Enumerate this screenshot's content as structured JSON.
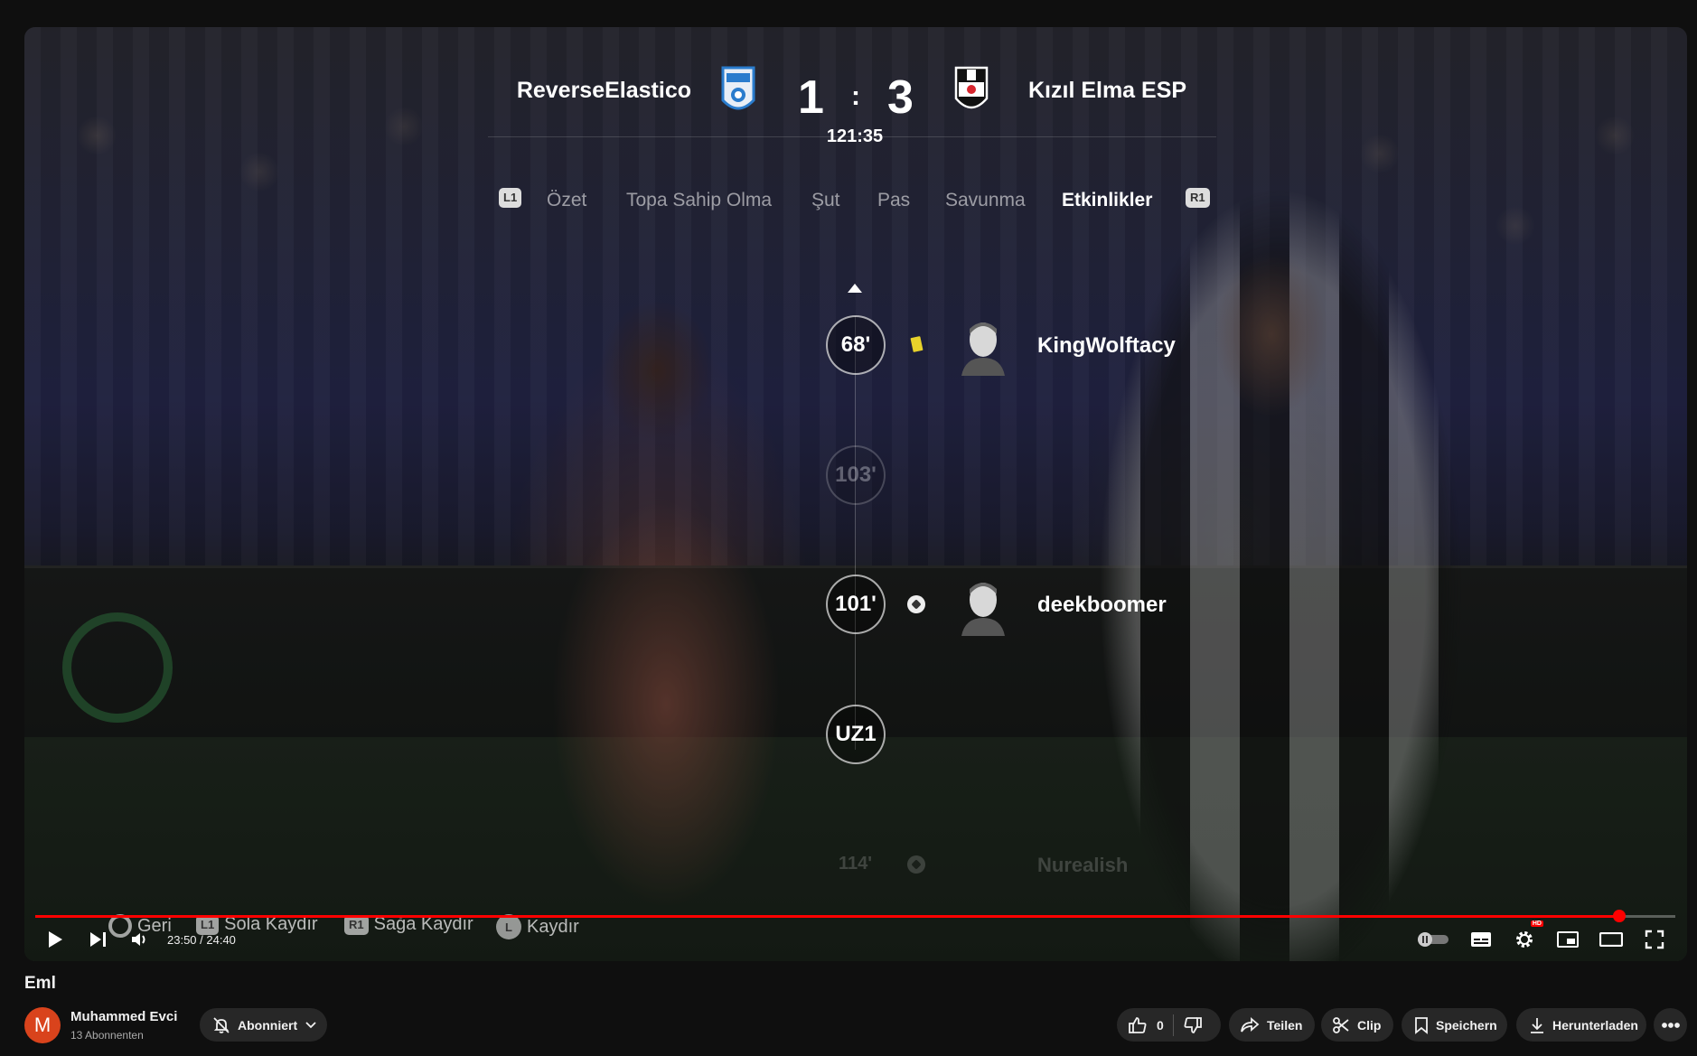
{
  "match": {
    "home_team": "ReverseElastico",
    "away_team": "Kızıl Elma ESP",
    "home_score": "1",
    "away_score": "3",
    "separator": ":",
    "clock": "121:35"
  },
  "tabs": {
    "left_tag": "L1",
    "right_tag": "R1",
    "items": [
      "Özet",
      "Topa Sahip Olma",
      "Şut",
      "Pas",
      "Savunma",
      "Etkinlikler"
    ],
    "active": "Etkinlikler"
  },
  "events": [
    {
      "minute": "68'",
      "icon": "yellow-card-icon",
      "player": "KingWolftacy"
    },
    {
      "minute": "103'",
      "icon": "",
      "player": ""
    },
    {
      "minute": "101'",
      "icon": "ball-icon",
      "player": "deekboomer"
    },
    {
      "minute": "UZ1",
      "icon": "",
      "player": ""
    },
    {
      "minute": "114'",
      "icon": "ball-icon",
      "player": "Nurealish"
    }
  ],
  "hints": {
    "back_label": "Geri",
    "left_tag": "L1",
    "left_label": "Sola Kaydır",
    "right_tag": "R1",
    "right_label": "Sağa Kaydır",
    "stick_tag": "L",
    "scroll_label": "Kaydır"
  },
  "player": {
    "time_display": "23:50 / 24:40",
    "progress": 0.966,
    "hd_badge": "HD"
  },
  "video": {
    "title": "Eml",
    "channel_initial": "M",
    "channel_name": "Muhammed Evci",
    "subscribers": "13 Abonnenten",
    "subscribed_label": "Abonniert",
    "like_count": "0",
    "share_label": "Teilen",
    "clip_label": "Clip",
    "save_label": "Speichern",
    "download_label": "Herunterladen"
  },
  "colors": {
    "accent": "#ff0000",
    "pill_bg": "#272727",
    "avatar_bg": "#d9431c"
  }
}
